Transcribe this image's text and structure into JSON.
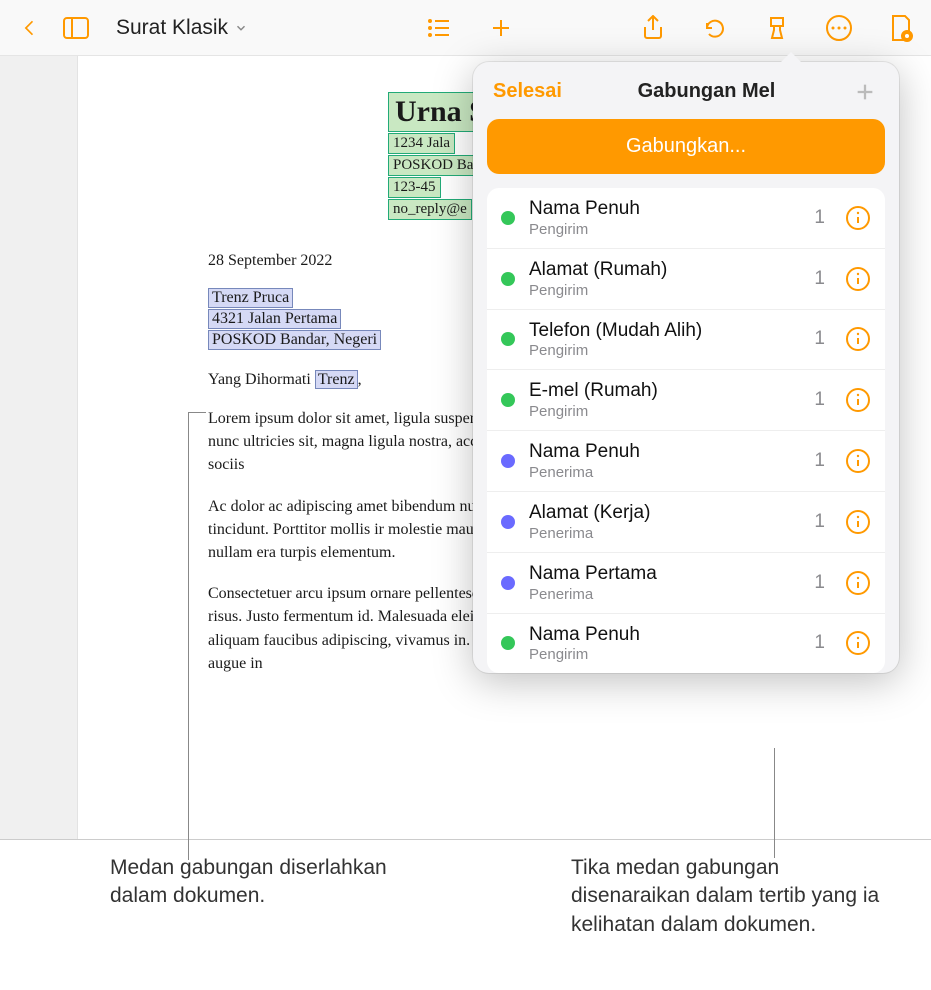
{
  "toolbar": {
    "doc_title": "Surat Klasik"
  },
  "document": {
    "sender": {
      "title": "Urna S",
      "line1": "1234 Jala",
      "line2": "POSKOD Ba",
      "line3": "123-45",
      "line4": "no_reply@e"
    },
    "date": "28 September 2022",
    "recipient": {
      "line1": "Trenz Pruca",
      "line2": "4321 Jalan Pertama",
      "line3": "POSKOD Bandar, Negeri"
    },
    "salutation_prefix": "Yang Dihormati ",
    "salutation_name": "Trenz",
    "salutation_suffix": ",",
    "paragraphs": [
      "Lorem ipsum dolor sit amet, ligula susper fermentum, enim integer ad vestibulum vo congue wisi enim nunc ultricies sit, magna ligula nostra, accumsan taciti. Sociis maur aliquet, sagittis felis sodales, dolor sociis ",
      "Ac dolor ac adipiscing amet bibendum nu et, pharetra sodales , feugiat ullamcorper aliquet, lectus tincidunt. Porttitor mollis ir molestie mauris ligula laoreet, vehicula ele sollicitudin amet eleifend dolor nullam era turpis elementum.",
      "Consectetuer arcu ipsum ornare pellentesque venenatis, in venenatis ullam, ornare magna erat felis wisi a risus. Justo fermentum id. Malesuada eleifend, tortor molestie, a a vel et. Mauris at suspendisse, neque aliquam faucibus adipiscing, vivamus in. Wisi mattis leo suscipit nec amet, nisl fermentum tempor ac a, augue in"
    ]
  },
  "popover": {
    "done_label": "Selesai",
    "title": "Gabungan Mel",
    "merge_button": "Gabungkan...",
    "fields": [
      {
        "label": "Nama Penuh",
        "sub": "Pengirim",
        "count": "1",
        "color": "green"
      },
      {
        "label": "Alamat (Rumah)",
        "sub": "Pengirim",
        "count": "1",
        "color": "green"
      },
      {
        "label": "Telefon (Mudah Alih)",
        "sub": "Pengirim",
        "count": "1",
        "color": "green"
      },
      {
        "label": "E-mel (Rumah)",
        "sub": "Pengirim",
        "count": "1",
        "color": "green"
      },
      {
        "label": "Nama Penuh",
        "sub": "Penerima",
        "count": "1",
        "color": "purple"
      },
      {
        "label": "Alamat (Kerja)",
        "sub": "Penerima",
        "count": "1",
        "color": "purple"
      },
      {
        "label": "Nama Pertama",
        "sub": "Penerima",
        "count": "1",
        "color": "purple"
      },
      {
        "label": "Nama Penuh",
        "sub": "Pengirim",
        "count": "1",
        "color": "green"
      }
    ]
  },
  "callouts": {
    "left": "Medan gabungan diserlahkan dalam dokumen.",
    "right": "Tika medan gabungan disenaraikan dalam tertib yang ia kelihatan dalam dokumen."
  }
}
